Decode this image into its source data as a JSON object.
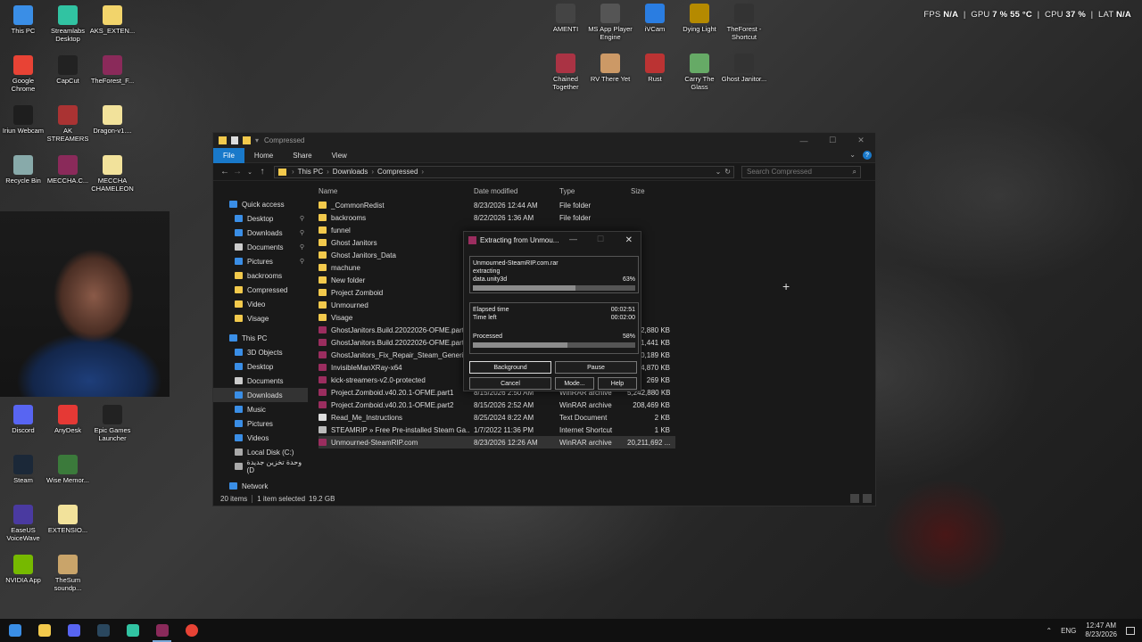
{
  "hud": {
    "fps_label": "FPS",
    "fps_value": "N/A",
    "gpu_label": "GPU",
    "gpu_value": "7 %",
    "gpu_temp": "55 °C",
    "cpu_label": "CPU",
    "cpu_value": "37 %",
    "lat_label": "LAT",
    "lat_value": "N/A"
  },
  "desktop_left": [
    {
      "label": "This PC",
      "icon": "this-pc-icon",
      "color": "#3a8ee6"
    },
    {
      "label": "Streamlabs Desktop",
      "icon": "streamlabs-icon",
      "color": "#31c3a2"
    },
    {
      "label": "AKS_EXTEN...",
      "icon": "folder-icon",
      "color": "#f2d46b"
    },
    {
      "label": "Google Chrome",
      "icon": "chrome-icon",
      "color": "#e84335"
    },
    {
      "label": "CapCut",
      "icon": "capcut-icon",
      "color": "#222222"
    },
    {
      "label": "TheForest_F...",
      "icon": "winrar-icon",
      "color": "#8a2a5a"
    },
    {
      "label": "Iriun Webcam",
      "icon": "iriun-icon",
      "color": "#1e1e1e"
    },
    {
      "label": "AK STREAMERS",
      "icon": "ak-icon",
      "color": "#a33"
    },
    {
      "label": "Dragon-v1....",
      "icon": "file-icon",
      "color": "#f2e29b"
    },
    {
      "label": "Recycle Bin",
      "icon": "recycle-bin-icon",
      "color": "#8aa"
    },
    {
      "label": "MECCHA.C...",
      "icon": "winrar-icon",
      "color": "#8a2a5a"
    },
    {
      "label": "MECCHA CHAMELEON",
      "icon": "file-icon",
      "color": "#f2e29b"
    },
    {
      "label": "Discord",
      "icon": "discord-icon",
      "color": "#5865f2"
    },
    {
      "label": "AnyDesk",
      "icon": "anydesk-icon",
      "color": "#e53935"
    },
    {
      "label": "Epic Games Launcher",
      "icon": "epic-icon",
      "color": "#222222"
    },
    {
      "label": "Steam",
      "icon": "steam-icon",
      "color": "#1b2838"
    },
    {
      "label": "Wise Memor...",
      "icon": "wise-icon",
      "color": "#3b7a3b"
    },
    {
      "label": "EaseUS VoiceWave",
      "icon": "easeus-icon",
      "color": "#4a3aa0"
    },
    {
      "label": "EXTENSIO...",
      "icon": "file-icon",
      "color": "#f2e29b"
    },
    {
      "label": "NVIDIA App",
      "icon": "nvidia-icon",
      "color": "#76b900"
    },
    {
      "label": "TheSum soundp...",
      "icon": "file-icon",
      "color": "#c9a46a"
    }
  ],
  "desktop_top": [
    {
      "label": "AMENTI",
      "icon": "game-icon",
      "color": "#444"
    },
    {
      "label": "MS App Player Engine",
      "icon": "game-icon",
      "color": "#555"
    },
    {
      "label": "iVCam",
      "icon": "ivcam-icon",
      "color": "#2a7de1"
    },
    {
      "label": "Dying Light",
      "icon": "game-icon",
      "color": "#b58a00"
    },
    {
      "label": "TheForest - Shortcut",
      "icon": "game-icon",
      "color": "#333"
    },
    {
      "label": "Chained Together",
      "icon": "game-icon",
      "color": "#a34"
    },
    {
      "label": "RV There Yet",
      "icon": "game-icon",
      "color": "#c96"
    },
    {
      "label": "Rust",
      "icon": "game-icon",
      "color": "#b33"
    },
    {
      "label": "Carry The Glass",
      "icon": "game-icon",
      "color": "#6a6"
    },
    {
      "label": "Ghost Janitor...",
      "icon": "game-icon",
      "color": "#333"
    }
  ],
  "explorer": {
    "title": "Compressed",
    "ribbon": [
      "File",
      "Home",
      "Share",
      "View"
    ],
    "path": [
      "This PC",
      "Downloads",
      "Compressed"
    ],
    "search_placeholder": "Search Compressed",
    "nav": [
      {
        "label": "Quick access",
        "pin": false,
        "color": "#3a8ee6"
      },
      {
        "label": "Desktop",
        "pin": true,
        "color": "#3a8ee6"
      },
      {
        "label": "Downloads",
        "pin": true,
        "color": "#3a8ee6"
      },
      {
        "label": "Documents",
        "pin": true,
        "color": "#ccc"
      },
      {
        "label": "Pictures",
        "pin": true,
        "color": "#3a8ee6"
      },
      {
        "label": "backrooms",
        "pin": false,
        "color": "#f2c94c"
      },
      {
        "label": "Compressed",
        "pin": false,
        "color": "#f2c94c"
      },
      {
        "label": "Video",
        "pin": false,
        "color": "#f2c94c"
      },
      {
        "label": "Visage",
        "pin": false,
        "color": "#f2c94c"
      },
      {
        "label": "",
        "pin": false,
        "color": ""
      },
      {
        "label": "This PC",
        "pin": false,
        "color": "#3a8ee6"
      },
      {
        "label": "3D Objects",
        "pin": false,
        "color": "#3a8ee6"
      },
      {
        "label": "Desktop",
        "pin": false,
        "color": "#3a8ee6"
      },
      {
        "label": "Documents",
        "pin": false,
        "color": "#ccc"
      },
      {
        "label": "Downloads",
        "pin": false,
        "color": "#3a8ee6"
      },
      {
        "label": "Music",
        "pin": false,
        "color": "#3a8ee6"
      },
      {
        "label": "Pictures",
        "pin": false,
        "color": "#3a8ee6"
      },
      {
        "label": "Videos",
        "pin": false,
        "color": "#3a8ee6"
      },
      {
        "label": "Local Disk (C:)",
        "pin": false,
        "color": "#aaa"
      },
      {
        "label": "وحدة تخزين جديدة (D",
        "pin": false,
        "color": "#aaa"
      },
      {
        "label": "",
        "pin": false,
        "color": ""
      },
      {
        "label": "Network",
        "pin": false,
        "color": "#3a8ee6"
      }
    ],
    "columns": [
      "Name",
      "Date modified",
      "Type",
      "Size"
    ],
    "files": [
      {
        "name": "_CommonRedist",
        "date": "8/23/2026 12:44 AM",
        "type": "File folder",
        "size": "",
        "kind": "folder"
      },
      {
        "name": "backrooms",
        "date": "8/22/2026 1:36 AM",
        "type": "File folder",
        "size": "",
        "kind": "folder"
      },
      {
        "name": "funnel",
        "date": "",
        "type": "",
        "size": "",
        "kind": "folder"
      },
      {
        "name": "Ghost Janitors",
        "date": "",
        "type": "",
        "size": "",
        "kind": "folder"
      },
      {
        "name": "Ghost Janitors_Data",
        "date": "",
        "type": "",
        "size": "",
        "kind": "folder"
      },
      {
        "name": "machune",
        "date": "",
        "type": "",
        "size": "",
        "kind": "folder"
      },
      {
        "name": "New folder",
        "date": "",
        "type": "",
        "size": "",
        "kind": "folder"
      },
      {
        "name": "Project Zomboid",
        "date": "",
        "type": "",
        "size": "",
        "kind": "folder"
      },
      {
        "name": "Unmourned",
        "date": "",
        "type": "",
        "size": "",
        "kind": "folder"
      },
      {
        "name": "Visage",
        "date": "",
        "type": "",
        "size": "",
        "kind": "folder"
      },
      {
        "name": "GhostJanitors.Build.22022026-OFME.part1",
        "date": "",
        "type": "",
        "size": "2,880 KB",
        "kind": "rar"
      },
      {
        "name": "GhostJanitors.Build.22022026-OFME.part2",
        "date": "",
        "type": "",
        "size": "1,441 KB",
        "kind": "rar"
      },
      {
        "name": "GhostJanitors_Fix_Repair_Steam_Generic",
        "date": "",
        "type": "",
        "size": "0,189 KB",
        "kind": "rar"
      },
      {
        "name": "InvisibleManXRay-x64",
        "date": "",
        "type": "",
        "size": "4,870 KB",
        "kind": "rar"
      },
      {
        "name": "kick-streamers-v2.0-protected",
        "date": "",
        "type": "",
        "size": "269 KB",
        "kind": "rar"
      },
      {
        "name": "Project.Zomboid.v40.20.1-OFME.part1",
        "date": "8/15/2026 2:50 AM",
        "type": "WinRAR archive",
        "size": "5,242,880 KB",
        "kind": "rar"
      },
      {
        "name": "Project.Zomboid.v40.20.1-OFME.part2",
        "date": "8/15/2026 2:52 AM",
        "type": "WinRAR archive",
        "size": "208,469 KB",
        "kind": "rar"
      },
      {
        "name": "Read_Me_Instructions",
        "date": "8/25/2024 8:22 AM",
        "type": "Text Document",
        "size": "2 KB",
        "kind": "txt"
      },
      {
        "name": "STEAMRIP » Free Pre-installed Steam Ga...",
        "date": "1/7/2022 11:36 PM",
        "type": "Internet Shortcut",
        "size": "1 KB",
        "kind": "link"
      },
      {
        "name": "Unmourned-SteamRIP.com",
        "date": "8/23/2026 12:26 AM",
        "type": "WinRAR archive",
        "size": "20,211,692 ...",
        "kind": "rar"
      }
    ],
    "status_items": "20 items",
    "status_selected": "1 item selected",
    "status_size": "19.2 GB"
  },
  "rar": {
    "title": "Extracting from Unmou...",
    "archive": "Unmourned-SteamRIP.com.rar",
    "action": "extracting",
    "file": "data.unity3d",
    "file_pct": "63%",
    "file_progress": 0.63,
    "elapsed_label": "Elapsed time",
    "elapsed": "00:02:51",
    "left_label": "Time left",
    "left": "00:02:00",
    "processed_label": "Processed",
    "processed_pct": "58%",
    "processed_progress": 0.58,
    "btn_background": "Background",
    "btn_pause": "Pause",
    "btn_cancel": "Cancel",
    "btn_mode": "Mode...",
    "btn_help": "Help"
  },
  "taskbar": {
    "apps": [
      {
        "name": "start",
        "color": "#3a8ee6"
      },
      {
        "name": "file-explorer",
        "color": "#f2c94c"
      },
      {
        "name": "discord",
        "color": "#5865f2"
      },
      {
        "name": "steam",
        "color": "#2a475e"
      },
      {
        "name": "streamlabs",
        "color": "#31c3a2"
      },
      {
        "name": "winrar",
        "color": "#8a2a5a"
      },
      {
        "name": "chrome",
        "color": "#e84335"
      }
    ],
    "lang": "ENG",
    "time": "12:47 AM",
    "date": "8/23/2026"
  }
}
